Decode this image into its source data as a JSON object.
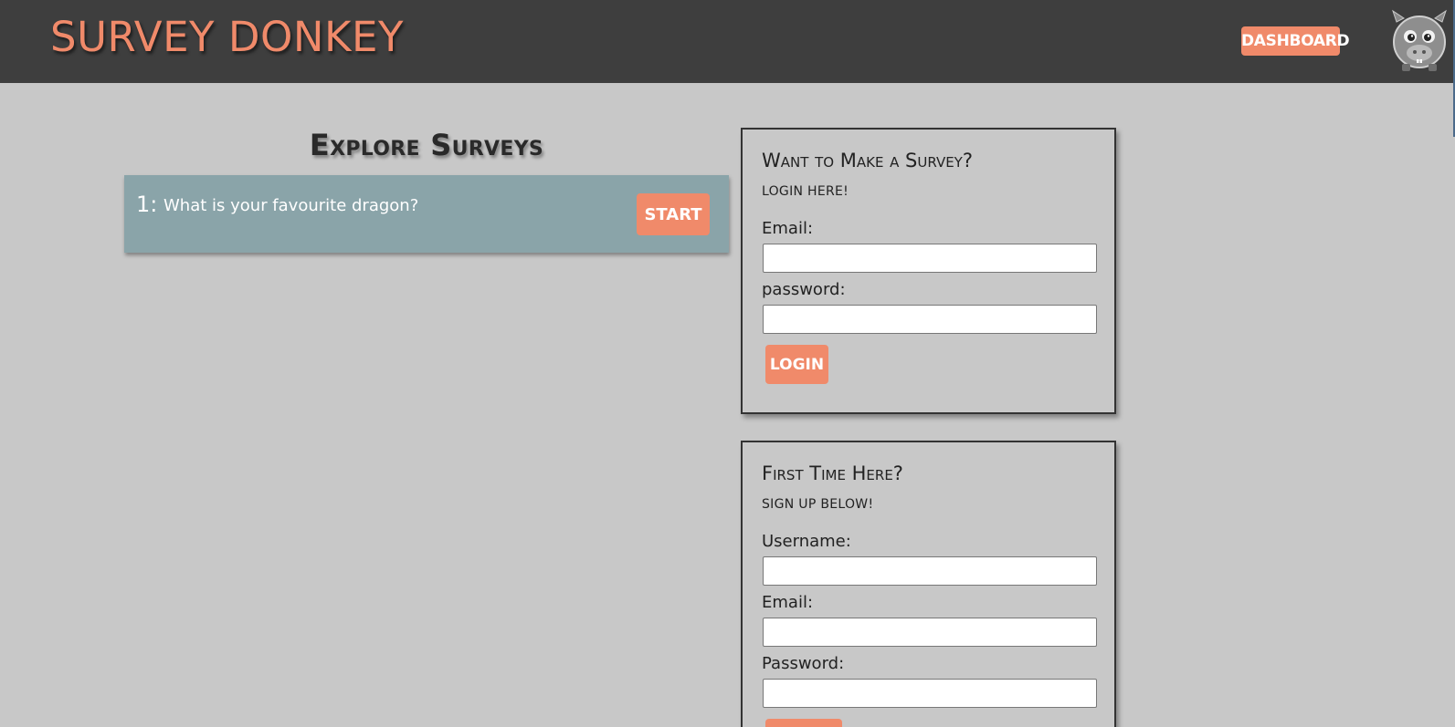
{
  "header": {
    "brand": "SURVEY DONKEY",
    "dashboard_label": "DASHBOARD",
    "avatar_icon": "donkey-avatar-icon"
  },
  "explore": {
    "title": "Explore Surveys",
    "surveys": [
      {
        "number": "1:",
        "question": "What is your favourite dragon?",
        "start_label": "START"
      }
    ]
  },
  "login_panel": {
    "title": "Want to Make a Survey?",
    "subtitle": "login here!",
    "email_label": "Email:",
    "email_value": "",
    "password_label": "password:",
    "password_value": "",
    "login_label": "LOGIN"
  },
  "signup_panel": {
    "title": "First Time Here?",
    "subtitle": "sign up below!",
    "username_label": "Username:",
    "username_value": "",
    "email_label": "Email:",
    "email_value": "",
    "password_label": "Password:",
    "password_value": "",
    "signup_label": ""
  },
  "colors": {
    "accent": "#f08a6a",
    "header_bg": "#3e3e3e",
    "page_bg": "#c8c8c8",
    "card_bg": "#8aa4a9"
  }
}
